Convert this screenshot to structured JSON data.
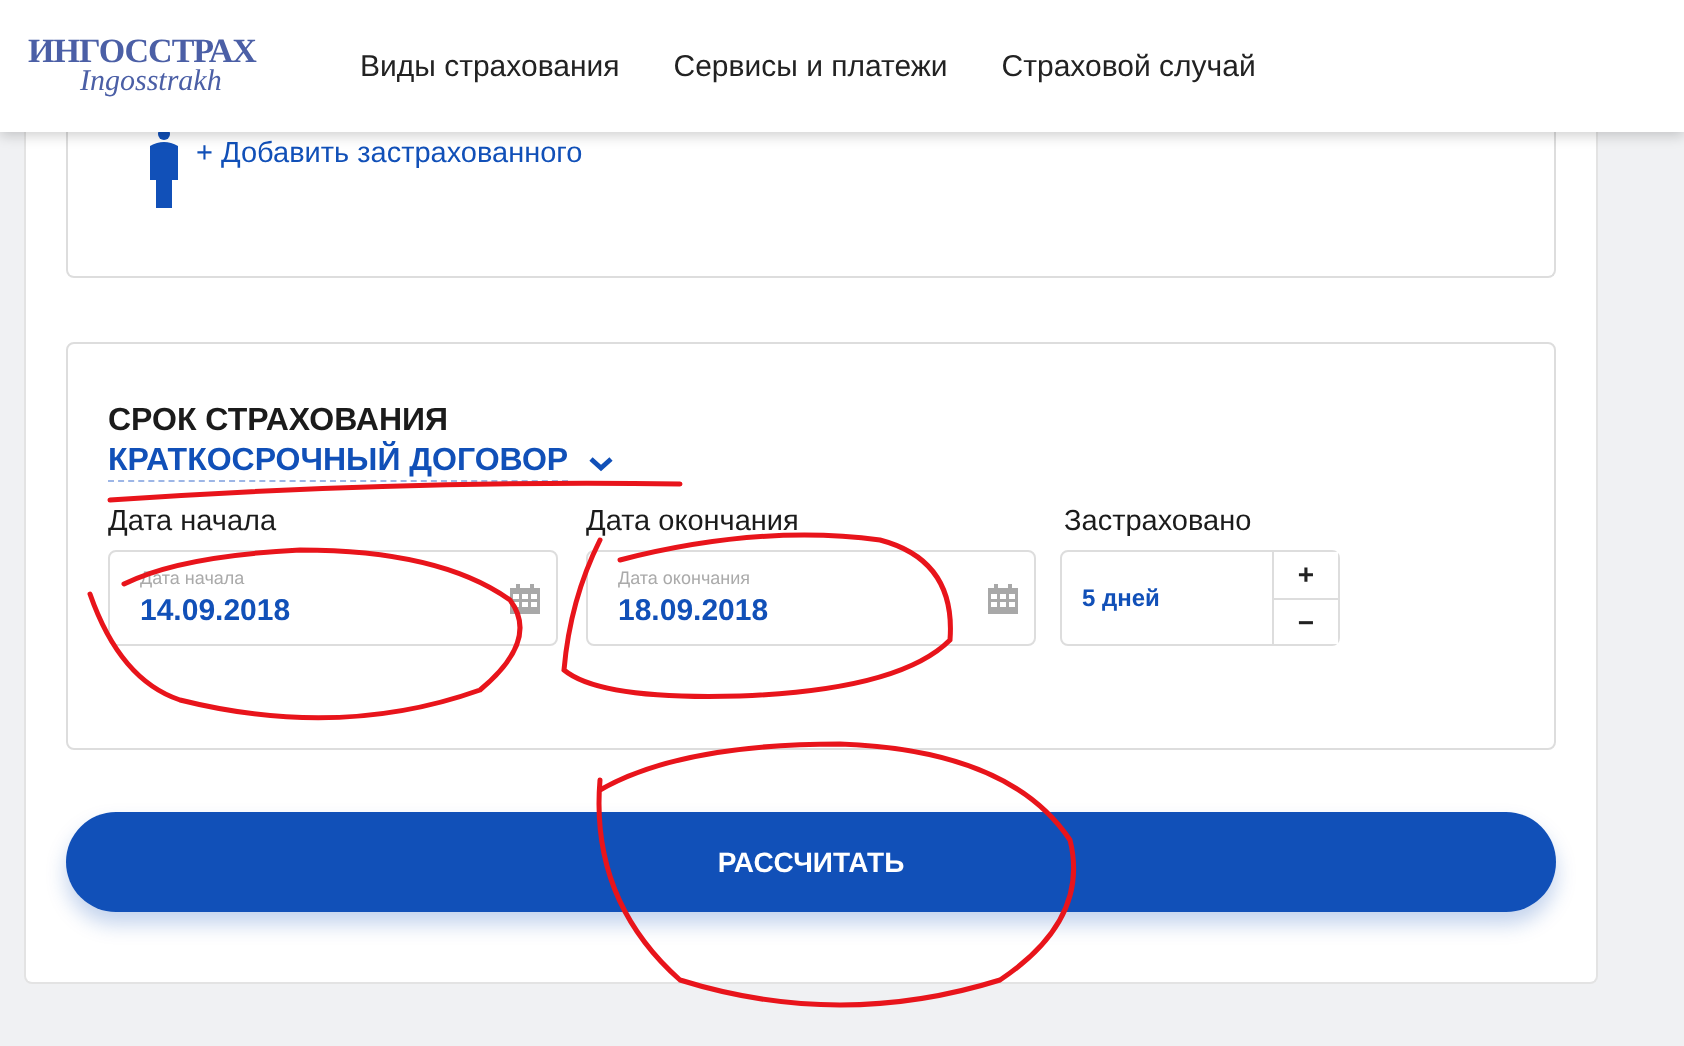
{
  "header": {
    "logo": {
      "title": "ИНГОССТРАХ",
      "subtitle": "Ingosstrakh"
    },
    "nav": [
      "Виды страхования",
      "Сервисы и платежи",
      "Страховой случай"
    ]
  },
  "insured": {
    "add_link": "+ Добавить застрахованного"
  },
  "term": {
    "title": "СРОК СТРАХОВАНИЯ",
    "contract_type": "КРАТКОСРОЧНЫЙ ДОГОВОР",
    "start": {
      "label": "Дата начала",
      "placeholder": "Дата начала",
      "value": "14.09.2018"
    },
    "end": {
      "label": "Дата окончания",
      "placeholder": "Дата окончания",
      "value": "18.09.2018"
    },
    "duration": {
      "label": "Застраховано",
      "value": "5 дней",
      "plus": "+",
      "minus": "−"
    }
  },
  "submit": "РАССЧИТАТЬ"
}
